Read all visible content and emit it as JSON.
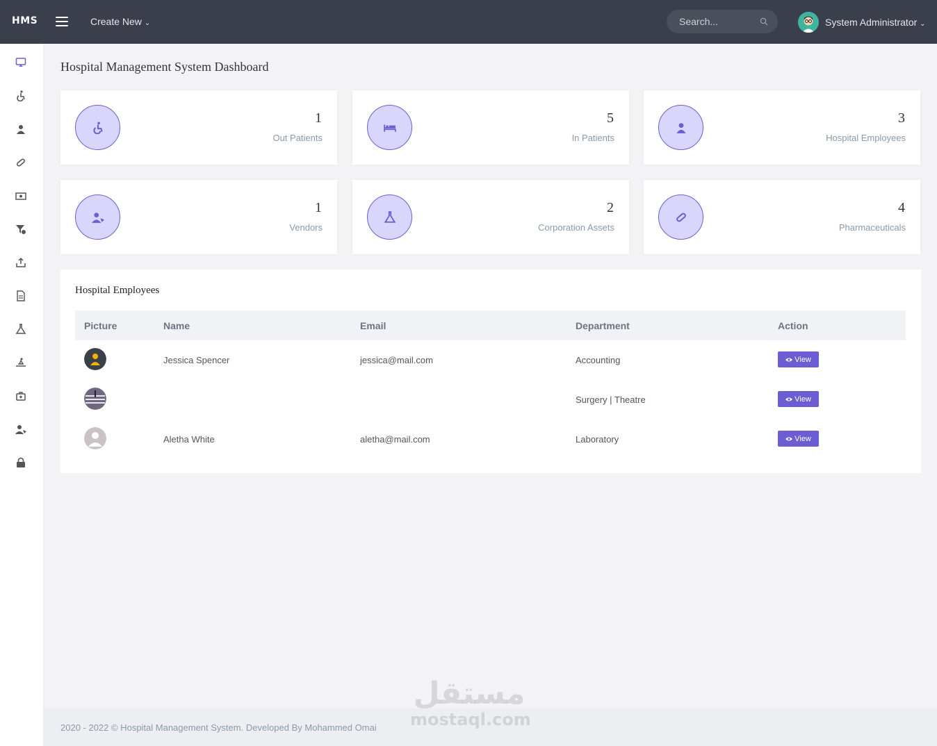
{
  "colors": {
    "topbar": "#3a3f4b",
    "accent": "#6c5dd3",
    "accent_light": "#d9d6fb"
  },
  "topbar": {
    "brand": "HMS",
    "create_new": "Create New",
    "search_placeholder": "Search...",
    "user_name": "System Administrator"
  },
  "sidebar": {
    "icons": [
      "dashboard-icon",
      "wheelchair-icon",
      "user-md-icon",
      "pill-icon",
      "money-icon",
      "funnel-dollar-icon",
      "upload-icon",
      "file-icon",
      "flask-icon",
      "procedure-icon",
      "medkit-icon",
      "user-tag-icon",
      "lock-icon"
    ]
  },
  "page_title": "Hospital Management System Dashboard",
  "stats": [
    {
      "value": "1",
      "label": "Out Patients",
      "icon": "wheelchair-icon"
    },
    {
      "value": "5",
      "label": "In Patients",
      "icon": "bed-icon"
    },
    {
      "value": "3",
      "label": "Hospital Employees",
      "icon": "user-md-icon"
    },
    {
      "value": "1",
      "label": "Vendors",
      "icon": "user-tag-icon"
    },
    {
      "value": "2",
      "label": "Corporation Assets",
      "icon": "flask-icon"
    },
    {
      "value": "4",
      "label": "Pharmaceuticals",
      "icon": "pill-icon"
    }
  ],
  "employees_panel": {
    "title": "Hospital Employees",
    "columns": [
      "Picture",
      "Name",
      "Email",
      "Department",
      "Action"
    ],
    "rows": [
      {
        "name": "Jessica Spencer",
        "email": "jessica@mail.com",
        "department": "Accounting",
        "action": "View"
      },
      {
        "name": "",
        "email": "",
        "department": "Surgery | Theatre",
        "action": "View"
      },
      {
        "name": "Aletha White",
        "email": "aletha@mail.com",
        "department": "Laboratory",
        "action": "View"
      }
    ]
  },
  "footer": {
    "text": "2020 - 2022 © Hospital Management System. Developed By Mohammed Omai"
  },
  "watermark": {
    "arabic": "مستقل",
    "latin": "mostaql.com"
  }
}
